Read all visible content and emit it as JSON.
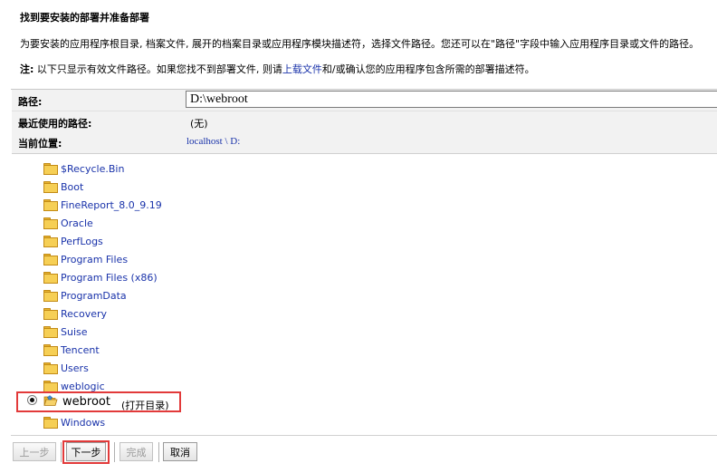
{
  "header": {
    "title": "找到要安装的部署并准备部署",
    "description": "为要安装的应用程序根目录, 档案文件, 展开的档案目录或应用程序模块描述符，选择文件路径。您还可以在\"路径\"字段中输入应用程序目录或文件的路径。",
    "note_label": "注:",
    "note_text_1": " 以下只显示有效文件路径。如果您找不到部署文件, 则请",
    "note_link": "上载文件",
    "note_text_2": "和/或确认您的应用程序包含所需的部署描述符。"
  },
  "path": {
    "label": "路径:",
    "value": "D:\\webroot"
  },
  "recent": {
    "label": "最近使用的路径:",
    "value": "(无)"
  },
  "current": {
    "label": "当前位置:",
    "value": "localhost \\ D:"
  },
  "tree": {
    "items": [
      "$Recycle.Bin",
      "Boot",
      "FineReport_8.0_9.19",
      "Oracle",
      "PerfLogs",
      "Program Files",
      "Program Files (x86)",
      "ProgramData",
      "Recovery",
      "Suise",
      "Tencent",
      "Users",
      "weblogic"
    ],
    "selected": {
      "label": "webroot",
      "open_label": "(打开目录)"
    },
    "after": "Windows"
  },
  "buttons": {
    "prev": "上一步",
    "next": "下一步",
    "finish": "完成",
    "cancel": "取消"
  },
  "colors": {
    "link": "#1a33aa",
    "highlight": "#e23a3a"
  }
}
